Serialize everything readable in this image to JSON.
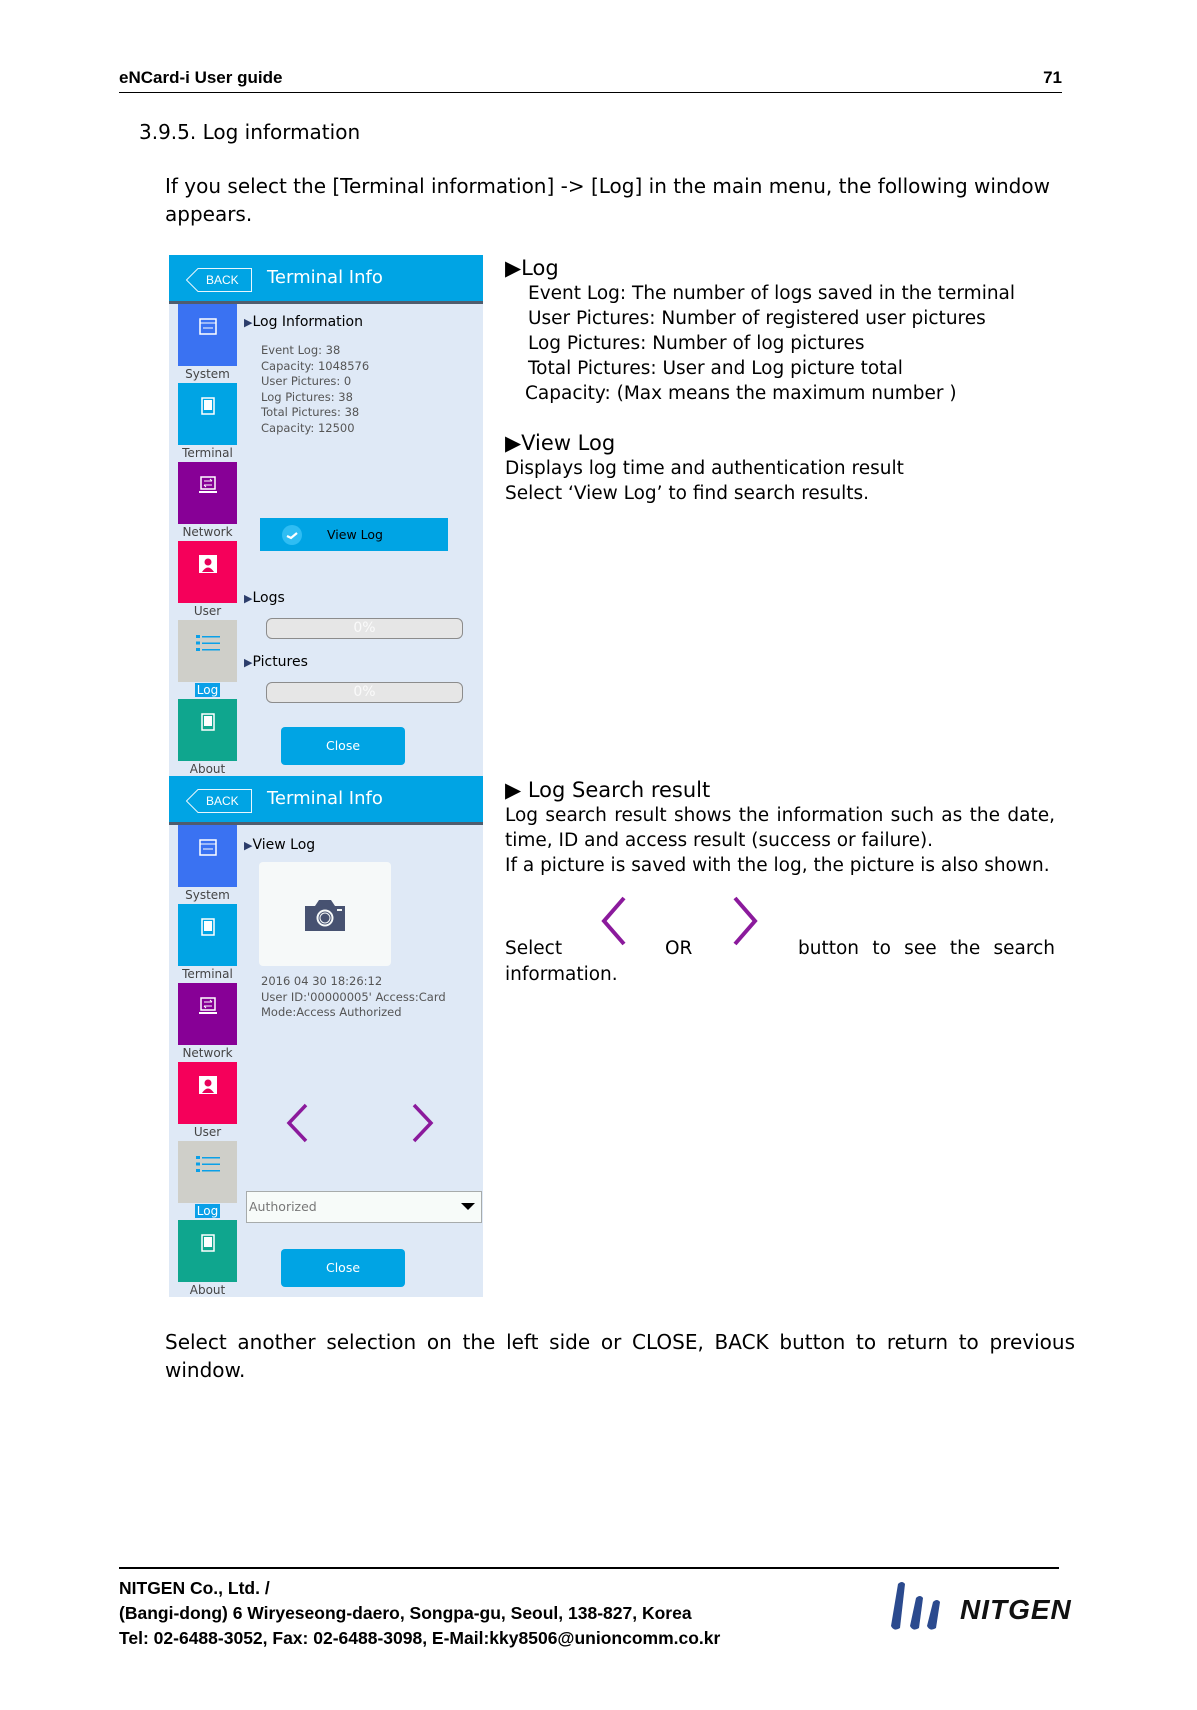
{
  "header": {
    "doc_title": "eNCard-i User guide",
    "page_number": "71"
  },
  "section_title": "3.9.5. Log information",
  "intro": "If you select the [Terminal information] -> [Log] in the main menu, the following window appears.",
  "device_common": {
    "back_label": "BACK",
    "title": "Terminal Info",
    "sidebar": [
      {
        "label": "System",
        "icon": "system-icon",
        "color": "#3a72f2"
      },
      {
        "label": "Terminal",
        "icon": "terminal-icon",
        "color": "#00a4e4"
      },
      {
        "label": "Network",
        "icon": "network-icon",
        "color": "#870096"
      },
      {
        "label": "User",
        "icon": "user-icon",
        "color": "#f5005a"
      },
      {
        "label": "Log",
        "icon": "list-icon",
        "color": "#cfcfc9",
        "selected": true
      },
      {
        "label": "About",
        "icon": "about-icon",
        "color": "#0fa68e"
      }
    ],
    "close_label": "Close"
  },
  "panel1": {
    "section": "Log Information",
    "info_lines": [
      "Event Log: 38",
      "Capacity: 1048576",
      "User Pictures: 0",
      "Log Pictures: 38",
      "Total Pictures: 38",
      "Capacity: 12500"
    ],
    "view_log_label": "View Log",
    "logs_label": "Logs",
    "logs_progress": {
      "percent": 0,
      "text": "0%"
    },
    "pictures_label": "Pictures",
    "pictures_progress": {
      "percent": 0,
      "text": "0%"
    }
  },
  "panel2": {
    "section": "View Log",
    "log_lines": [
      "2016 04 30 18:26:12",
      "User ID:'00000005' Access:Card",
      "Mode:Access Authorized"
    ],
    "filter_value": "Authorized"
  },
  "desc1": {
    "heading1": "Log",
    "log_lines": [
      "Event Log: The number of logs saved in the terminal",
      "User Pictures: Number of registered user pictures",
      "Log Pictures: Number of log pictures",
      "Total Pictures: User and Log picture total",
      "Capacity: (Max means the maximum number )"
    ],
    "heading2": "View Log",
    "view_lines": [
      "Displays log time and authentication result",
      "Select ‘View Log’ to find search results."
    ]
  },
  "desc2": {
    "heading": "Log Search result",
    "paragraph": "Log search result shows the information such as the date, time, ID and access result (success or failure).",
    "picture_line": "If a picture is saved with the log, the picture is also shown.",
    "select_word": "Select",
    "or_word": "OR",
    "tail": "button to see the search",
    "tail2": "information."
  },
  "closing_text": "Select another selection on the left side or CLOSE, BACK button to return to previous window.",
  "footer": {
    "line1": "NITGEN Co., Ltd. /",
    "line2": "(Bangi-dong) 6 Wiryeseong-daero, Songpa-gu, Seoul, 138-827, Korea",
    "line3": "Tel: 02-6488-3052, Fax: 02-6488-3098, E-Mail:kky8506@unioncomm.co.kr",
    "logo_text": "NITGEN",
    "logo_color": "#2b4a8e"
  },
  "colors": {
    "accent": "#00a4e4",
    "nav_arrow": "#8b1a9c",
    "panel_bg": "#dfe9f6"
  }
}
